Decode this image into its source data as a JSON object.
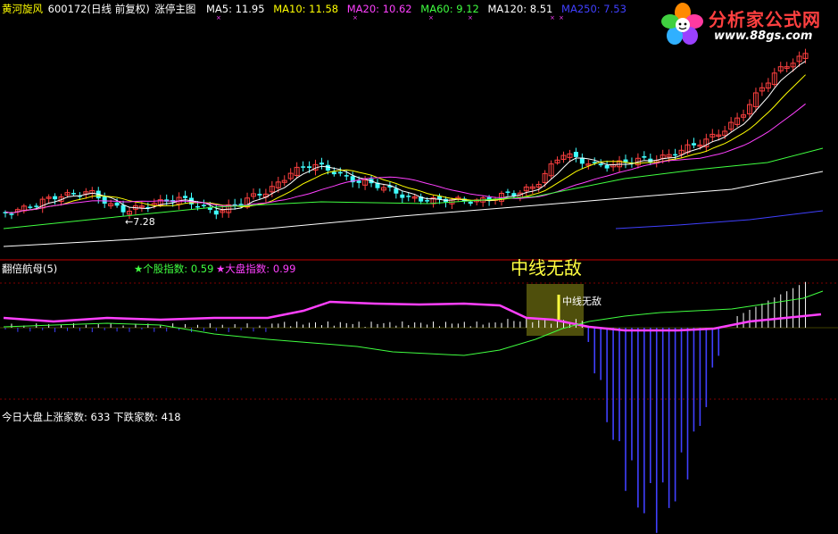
{
  "header": {
    "name": "黄河旋风",
    "code": "600172(日线 前复权)",
    "indicator": "涨停主图",
    "ma": [
      {
        "label": "MA5: 11.95",
        "color": "#ffffff"
      },
      {
        "label": "MA10: 11.58",
        "color": "#ffff00"
      },
      {
        "label": "MA20: 10.62",
        "color": "#ff40ff"
      },
      {
        "label": "MA60: 9.12",
        "color": "#40ff40"
      },
      {
        "label": "MA120: 8.51",
        "color": "#ffffff"
      },
      {
        "label": "MA250: 7.53",
        "color": "#4040ff"
      }
    ]
  },
  "logo": {
    "title": "分析家公式网",
    "url": "www.88gs.com"
  },
  "main_panel": {
    "low_marker": "←7.28"
  },
  "sub_panel": {
    "name": "翻倍航母(5)",
    "stock_index": "★个股指数: 0.59",
    "market_index": "★大盘指数: 0.99",
    "signal_big": "中线无敌",
    "signal_small": "中线无敌"
  },
  "bottom": {
    "breadth": "今日大盘上涨家数: 633 下跌家数: 418"
  },
  "colors": {
    "up": "#ff4040",
    "down": "#40ffff",
    "ma5": "#ffffff",
    "ma10": "#ffff00",
    "ma20": "#ff40ff",
    "ma60": "#40ff40",
    "ma120": "#ffffff",
    "ma250": "#4040ff",
    "separator": "#c00000",
    "grid": "#800000",
    "signal": "#ffff40"
  }
}
